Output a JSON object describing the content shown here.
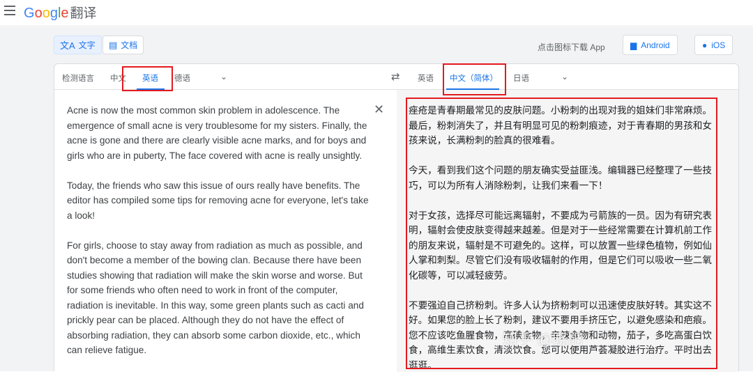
{
  "header": {
    "logo_g": "G",
    "logo_o1": "o",
    "logo_o2": "o",
    "logo_g2": "g",
    "logo_l": "l",
    "logo_e": "e",
    "logo_cn": "翻译"
  },
  "modes": {
    "text_label": "文字",
    "doc_label": "文档"
  },
  "download": {
    "label": "点击图标下载 App",
    "android": "Android",
    "ios": "iOS"
  },
  "source_langs": {
    "detect": "检测语言",
    "chinese": "中文",
    "english": "英语",
    "german": "德语"
  },
  "target_langs": {
    "english": "英语",
    "chinese_simplified": "中文（简体）",
    "japanese": "日语"
  },
  "source": {
    "paragraphs": [
      "Acne is now the most common skin problem in adolescence. The emergence of small acne is very troublesome for my sisters. Finally, the acne is gone and there are clearly visible acne marks, and for boys and girls who are in puberty, The face covered with acne is really unsightly.",
      "Today, the friends who saw this issue of ours really have benefits. The editor has compiled some tips for removing acne for everyone, let's take a look!",
      "For girls, choose to stay away from radiation as much as possible, and don't become a member of the bowing clan. Because there have been studies showing that radiation will make the skin worse and worse. But for some friends who often need to work in front of the computer, radiation is inevitable. In this way, some green plants such as cacti and prickly pear can be placed. Although they do not have the effect of absorbing radiation, they can absorb some carbon dioxide, etc., which can relieve fatigue."
    ]
  },
  "target": {
    "paragraphs": [
      "痤疮是青春期最常见的皮肤问题。小粉刺的出现对我的姐妹们非常麻烦。最后，粉刺消失了，并且有明显可见的粉刺痕迹，对于青春期的男孩和女孩来说，长满粉刺的脸真的很难看。",
      "今天，看到我们这个问题的朋友确实受益匪浅。编辑器已经整理了一些技巧，可以为所有人消除粉刺，让我们来看一下！",
      "对于女孩，选择尽可能远离辐射，不要成为弓箭族的一员。因为有研究表明，辐射会使皮肤变得越来越差。但是对于一些经常需要在计算机前工作的朋友来说，辐射是不可避免的。这样，可以放置一些绿色植物，例如仙人掌和刺梨。尽管它们没有吸收辐射的作用，但是它们可以吸收一些二氧化碳等，可以减轻疲劳。",
      "不要强迫自己挤粉刺。许多人认为挤粉刺可以迅速使皮肤好转。其实这不好。如果您的脸上长了粉刺，建议不要用手挤压它，以避免感染和疤痕。您不应该吃鱼腥食物，高碘食物，辛辣食物和动物，茄子，多吃高蛋白饮食，高维生素饮食，清淡饮食。您可以使用芦荟凝胶进行治疗。平时出去逛逛。"
    ]
  },
  "watermark": "知乎 @晓阳",
  "colors": {
    "accent": "#1a73e8",
    "highlight": "#e3191e"
  }
}
